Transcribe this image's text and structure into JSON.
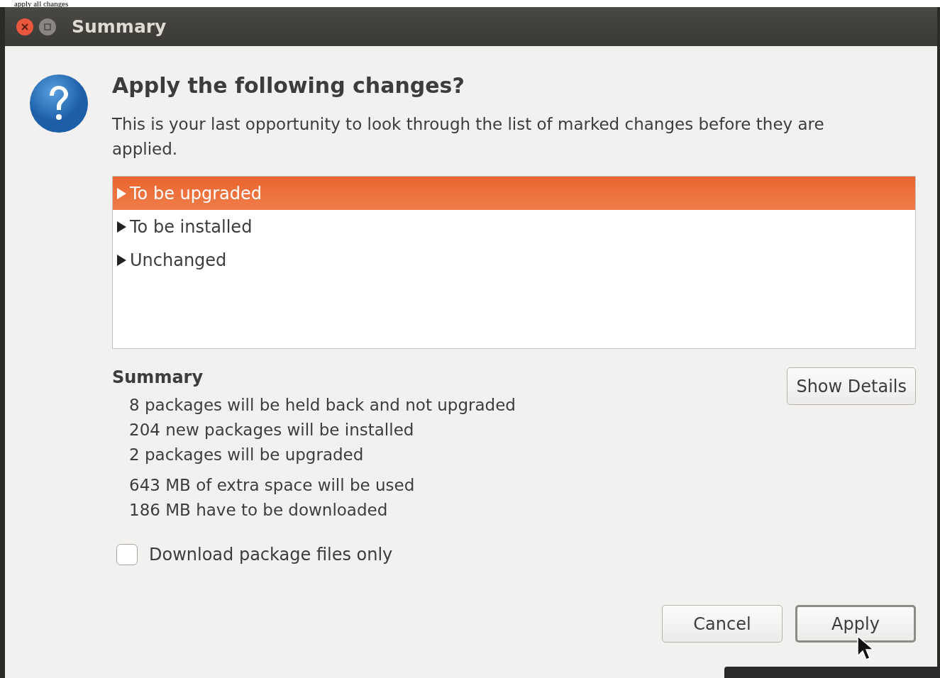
{
  "caption": "apply all changes",
  "window": {
    "title": "Summary"
  },
  "dialog": {
    "heading": "Apply the following changes?",
    "message": "This is your last opportunity to look through the list of marked changes before they are applied."
  },
  "changes": [
    {
      "label": "To be upgraded",
      "selected": true,
      "expanded": false
    },
    {
      "label": "To be installed",
      "selected": false,
      "expanded": false
    },
    {
      "label": "Unchanged",
      "selected": false,
      "expanded": false
    }
  ],
  "summary": {
    "title": "Summary",
    "groups": [
      [
        "8 packages will be held back and not upgraded",
        "204 new packages will be installed",
        "2 packages will be upgraded"
      ],
      [
        "643 MB of extra space will be used",
        "186 MB have to be downloaded"
      ]
    ],
    "details_button": "Show Details"
  },
  "download_only": {
    "label": "Download package files only",
    "checked": false
  },
  "buttons": [
    {
      "label": "Cancel",
      "default": false
    },
    {
      "label": "Apply",
      "default": true
    }
  ]
}
